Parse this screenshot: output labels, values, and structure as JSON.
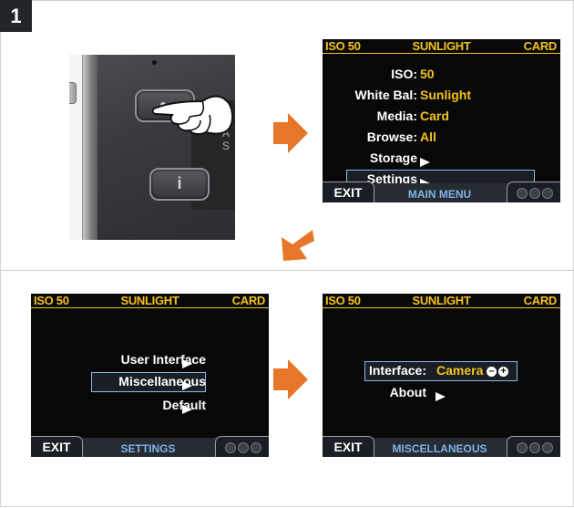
{
  "step": "1",
  "camera": {
    "info_glyph": "i",
    "logo": "A S"
  },
  "screens": [
    {
      "header": {
        "left": "ISO 50",
        "center": "SUNLIGHT",
        "right": "CARD"
      },
      "rows": [
        {
          "label": "ISO:",
          "value": "50"
        },
        {
          "label": "White Bal:",
          "value": "Sunlight"
        },
        {
          "label": "Media:",
          "value": "Card"
        },
        {
          "label": "Browse:",
          "value": "All"
        },
        {
          "label": "Storage",
          "value": ""
        },
        {
          "label": "Settings",
          "value": ""
        }
      ],
      "footer": {
        "exit": "EXIT",
        "title": "MAIN MENU"
      }
    },
    {
      "header": {
        "left": "ISO 50",
        "center": "SUNLIGHT",
        "right": "CARD"
      },
      "rows": [
        {
          "label": "User Interface"
        },
        {
          "label": "Miscellaneous"
        },
        {
          "label": "Default"
        }
      ],
      "footer": {
        "exit": "EXIT",
        "title": "SETTINGS"
      }
    },
    {
      "header": {
        "left": "ISO 50",
        "center": "SUNLIGHT",
        "right": "CARD"
      },
      "rows": [
        {
          "label": "Interface:",
          "value": "Camera"
        },
        {
          "label": "About"
        }
      ],
      "footer": {
        "exit": "EXIT",
        "title": "MISCELLANEOUS"
      }
    }
  ],
  "colors": {
    "accent": "#f4c21c",
    "selection": "#8db7e6",
    "title": "#7fb3e8",
    "arrow": "#e5762a",
    "step_badge": "#22262b"
  },
  "icons": {
    "minus": "minus-circle-icon",
    "plus": "plus-circle-icon",
    "arrow": "arrow-icon",
    "hand": "pointing-hand-icon"
  }
}
